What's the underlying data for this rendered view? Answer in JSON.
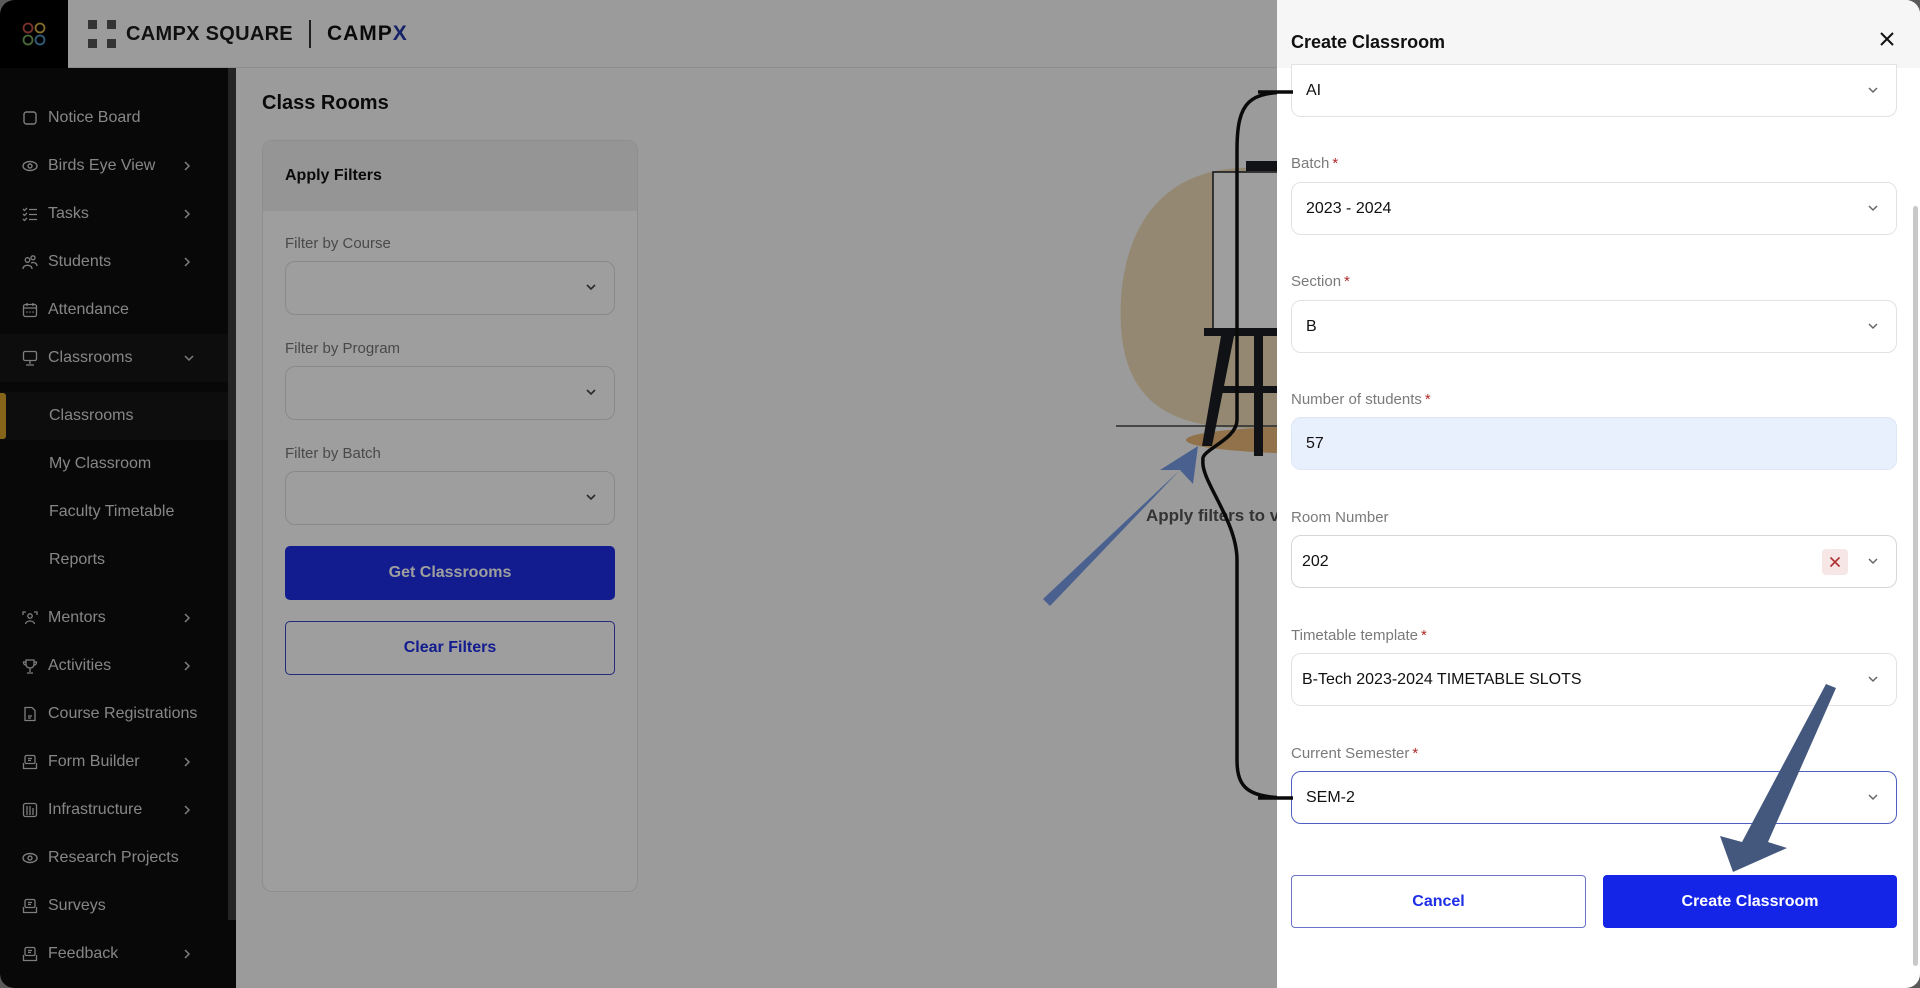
{
  "header": {
    "brand_primary": "CAMPX SQUARE",
    "brand_secondary_main": "CAMP",
    "brand_secondary_accent": "X"
  },
  "sidebar": {
    "items": [
      {
        "label": "Notice Board",
        "icon": "square-icon",
        "has_chevron": false
      },
      {
        "label": "Birds Eye View",
        "icon": "eye-icon",
        "has_chevron": true
      },
      {
        "label": "Tasks",
        "icon": "checklist-icon",
        "has_chevron": true
      },
      {
        "label": "Students",
        "icon": "users-icon",
        "has_chevron": true
      },
      {
        "label": "Attendance",
        "icon": "calendar-icon",
        "has_chevron": false
      },
      {
        "label": "Classrooms",
        "icon": "presentation-icon",
        "has_chevron": true,
        "expanded": true
      },
      {
        "label": "Mentors",
        "icon": "mentor-icon",
        "has_chevron": true
      },
      {
        "label": "Activities",
        "icon": "trophy-icon",
        "has_chevron": true
      },
      {
        "label": "Course Registrations",
        "icon": "document-icon",
        "has_chevron": false
      },
      {
        "label": "Form Builder",
        "icon": "form-icon",
        "has_chevron": true
      },
      {
        "label": "Infrastructure",
        "icon": "building-icon",
        "has_chevron": true
      },
      {
        "label": "Research Projects",
        "icon": "eye-icon",
        "has_chevron": false
      },
      {
        "label": "Surveys",
        "icon": "form-icon",
        "has_chevron": false
      },
      {
        "label": "Feedback",
        "icon": "form-icon",
        "has_chevron": true
      }
    ],
    "sub_items": [
      {
        "label": "Classrooms",
        "active": true
      },
      {
        "label": "My Classroom",
        "active": false
      },
      {
        "label": "Faculty Timetable",
        "active": false
      },
      {
        "label": "Reports",
        "active": false
      }
    ]
  },
  "main": {
    "page_title": "Class Rooms",
    "filters": {
      "title": "Apply Filters",
      "course_label": "Filter by Course",
      "course_value": "",
      "program_label": "Filter by Program",
      "program_value": "",
      "batch_label": "Filter by Batch",
      "batch_value": "",
      "get_button": "Get Classrooms",
      "clear_button": "Clear Filters"
    },
    "empty_state_text": "Apply filters to v"
  },
  "modal": {
    "title": "Create Classroom",
    "fields": {
      "program_value": "AI",
      "batch_label": "Batch",
      "batch_value": "2023 - 2024",
      "section_label": "Section",
      "section_value": "B",
      "students_label": "Number of students",
      "students_value": "57",
      "room_label": "Room Number",
      "room_value": "202",
      "timetable_label": "Timetable template",
      "timetable_value": "B-Tech 2023-2024 TIMETABLE SLOTS",
      "semester_label": "Current Semester",
      "semester_value": "SEM-2"
    },
    "required_mark": "*",
    "cancel_button": "Cancel",
    "create_button": "Create Classroom"
  },
  "colors": {
    "primary": "#1525e8",
    "active_indicator": "#d9a22b",
    "required": "#b02a2a",
    "annotation_arrow": "#4a6190"
  }
}
